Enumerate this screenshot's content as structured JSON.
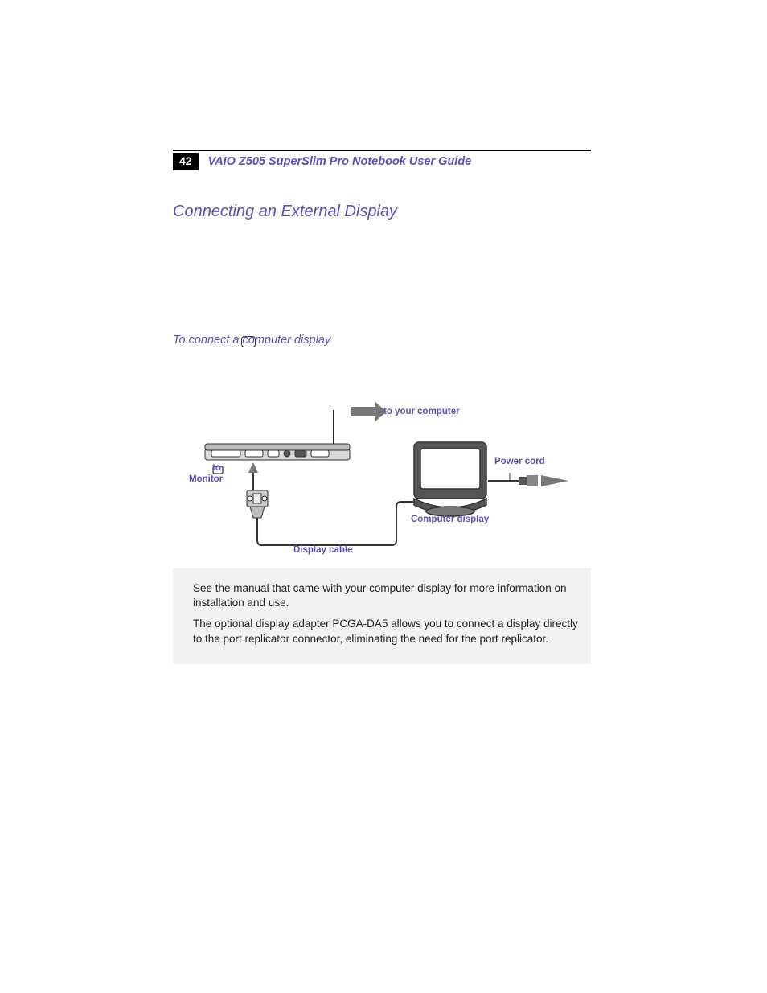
{
  "header": {
    "page_number": "42",
    "guide_title": "VAIO Z505 SuperSlim Pro Notebook User Guide"
  },
  "section": {
    "title": "Connecting an External Display",
    "subtitle": "To connect a computer display"
  },
  "figure": {
    "labels": {
      "to_computer": "to your computer",
      "power_cord": "Power cord",
      "to_monitor_line1": "to",
      "to_monitor_line2": "Monitor",
      "computer_display": "Computer display",
      "display_cable": "Display cable"
    }
  },
  "notes": {
    "p1": "See the manual that came with your computer display for more information on installation and use.",
    "p2": "The optional display adapter PCGA-DA5 allows you to connect a display directly to the port replicator connector, eliminating the need for the port replicator."
  }
}
